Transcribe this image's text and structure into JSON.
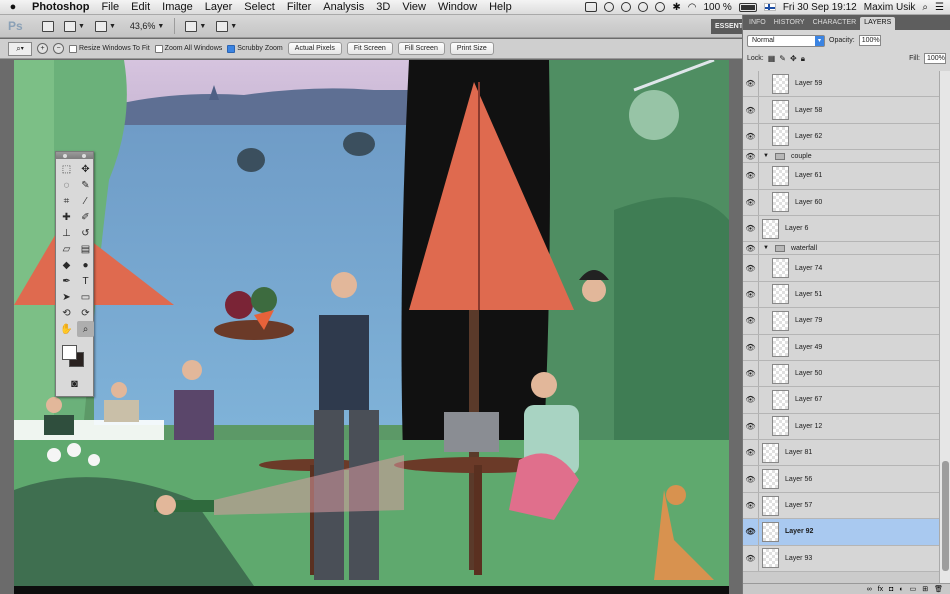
{
  "menubar": {
    "app": "Photoshop",
    "items": [
      "File",
      "Edit",
      "Image",
      "Layer",
      "Select",
      "Filter",
      "Analysis",
      "3D",
      "View",
      "Window",
      "Help"
    ],
    "battery": "100 %",
    "datetime": "Fri 30 Sep 19:12",
    "user": "Maxim Usik"
  },
  "appbar": {
    "logo": "Ps",
    "zoom": "43,6%"
  },
  "options": {
    "resize": "Resize Windows To Fit",
    "zoom_all": "Zoom All Windows",
    "scrubby": "Scrubby Zoom",
    "actual": "Actual Pixels",
    "fit": "Fit Screen",
    "fill": "Fill Screen",
    "print": "Print Size"
  },
  "workspace": "ESSENT",
  "panel": {
    "tabs": [
      "INFO",
      "HISTORY",
      "CHARACTER",
      "LAYERS"
    ],
    "blend": "Normal",
    "opacity_label": "Opacity:",
    "opacity": "100%",
    "lock_label": "Lock:",
    "fill_label": "Fill:",
    "fill": "100%"
  },
  "layers": [
    {
      "name": "Layer 59",
      "type": "layer",
      "indent": true
    },
    {
      "name": "Layer 58",
      "type": "layer",
      "indent": true
    },
    {
      "name": "Layer 62",
      "type": "layer",
      "indent": true
    },
    {
      "name": "couple",
      "type": "group"
    },
    {
      "name": "Layer 61",
      "type": "layer",
      "indent": true
    },
    {
      "name": "Layer 60",
      "type": "layer",
      "indent": true
    },
    {
      "name": "Layer 6",
      "type": "layer",
      "indent": false
    },
    {
      "name": "waterfall",
      "type": "group"
    },
    {
      "name": "Layer 74",
      "type": "layer",
      "indent": true
    },
    {
      "name": "Layer 51",
      "type": "layer",
      "indent": true
    },
    {
      "name": "Layer 79",
      "type": "layer",
      "indent": true
    },
    {
      "name": "Layer 49",
      "type": "layer",
      "indent": true
    },
    {
      "name": "Layer 50",
      "type": "layer",
      "indent": true
    },
    {
      "name": "Layer 67",
      "type": "layer",
      "indent": true
    },
    {
      "name": "Layer 12",
      "type": "layer",
      "indent": true
    },
    {
      "name": "Layer 81",
      "type": "layer",
      "indent": false
    },
    {
      "name": "Layer 56",
      "type": "layer",
      "indent": false
    },
    {
      "name": "Layer 57",
      "type": "layer",
      "indent": false
    },
    {
      "name": "Layer 92",
      "type": "layer",
      "indent": false,
      "selected": true
    },
    {
      "name": "Layer 93",
      "type": "layer",
      "indent": false
    }
  ],
  "colors": {
    "foreground": "#ffffff",
    "background": "#2a2220",
    "selection": "#a9c9f0"
  }
}
